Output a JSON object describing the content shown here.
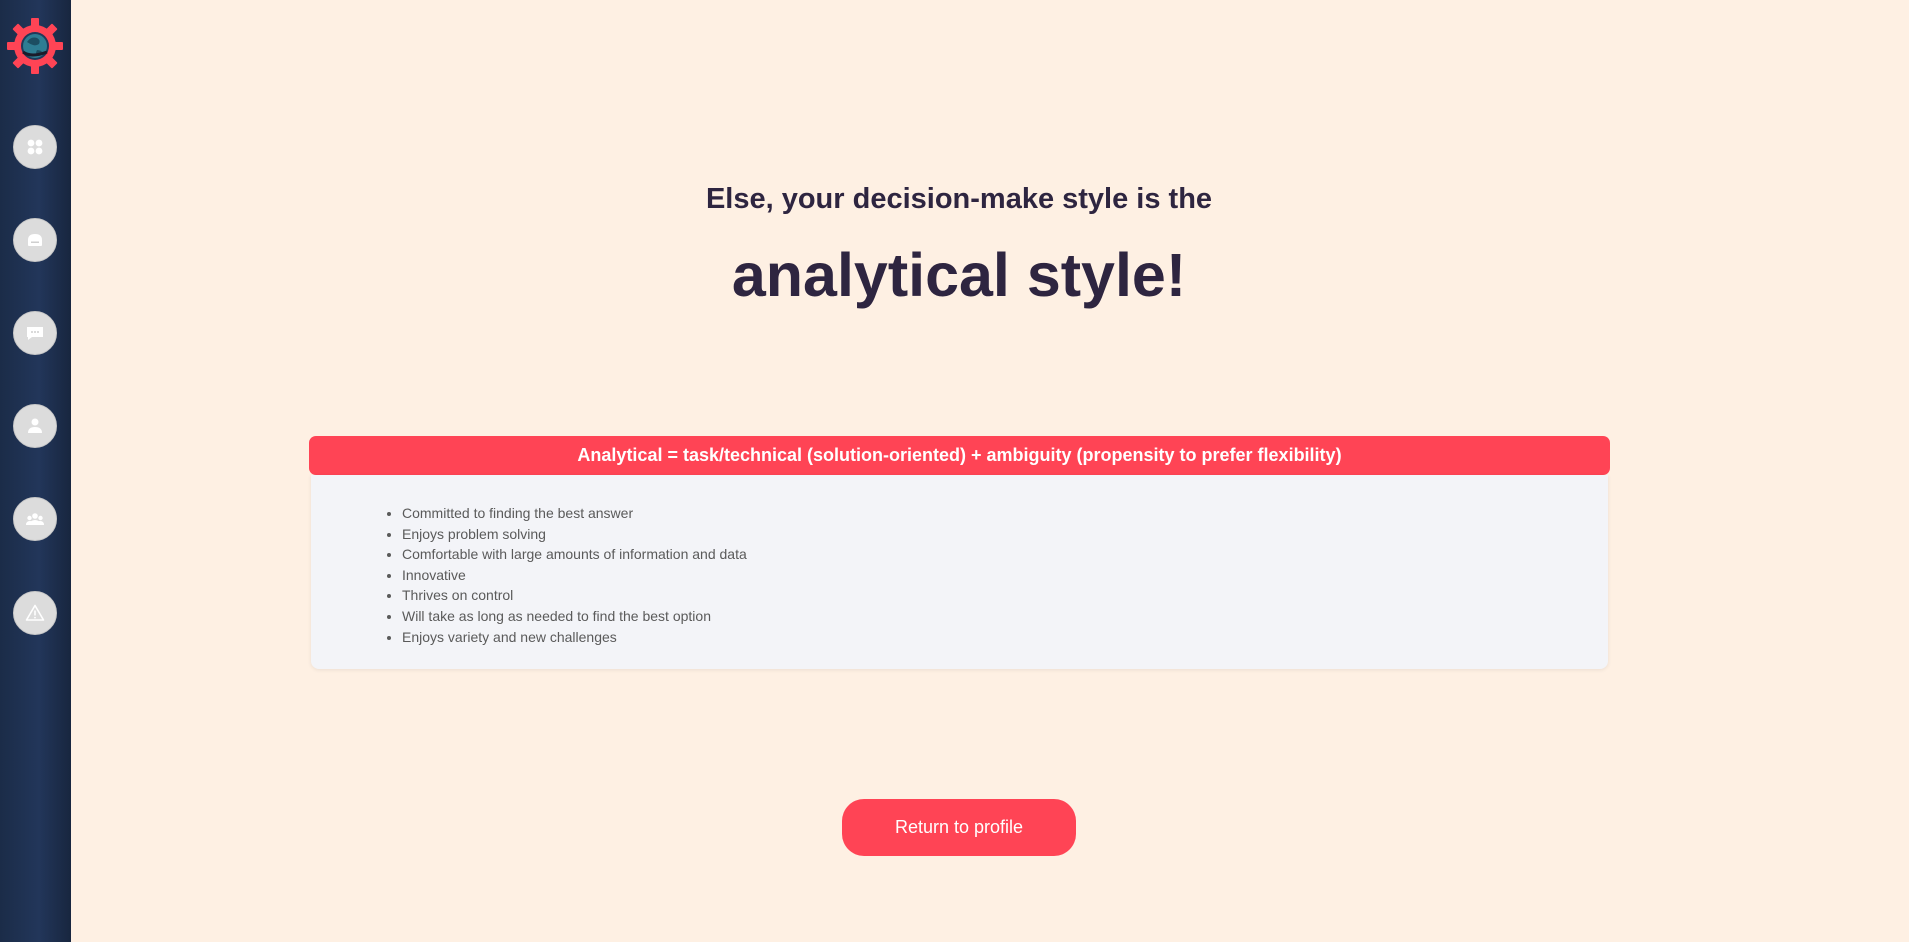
{
  "sidebar": {
    "logo_icon": "gear-globe-logo",
    "items": [
      {
        "name": "dashboard",
        "icon": "grid-icon"
      },
      {
        "name": "profile",
        "icon": "id-card-icon"
      },
      {
        "name": "messages",
        "icon": "chat-icon"
      },
      {
        "name": "account",
        "icon": "user-icon"
      },
      {
        "name": "team",
        "icon": "group-icon"
      },
      {
        "name": "alerts",
        "icon": "warning-icon"
      }
    ]
  },
  "result": {
    "subtitle": "Else, your decision-make style is the",
    "title": "analytical style!"
  },
  "card": {
    "header": "Analytical = task/technical (solution-oriented) + ambiguity (propensity to prefer flexibility)",
    "traits": [
      "Committed to finding the best answer",
      "Enjoys problem solving",
      "Comfortable with large amounts of information and data",
      "Innovative",
      "Thrives on control",
      "Will take as long as needed to find the best option",
      "Enjoys variety and new challenges"
    ]
  },
  "actions": {
    "return_label": "Return to profile"
  },
  "colors": {
    "accent": "#ff4455",
    "background": "#fef0e3",
    "sidebar": "#1e3050",
    "text_dark": "#2e2540"
  }
}
